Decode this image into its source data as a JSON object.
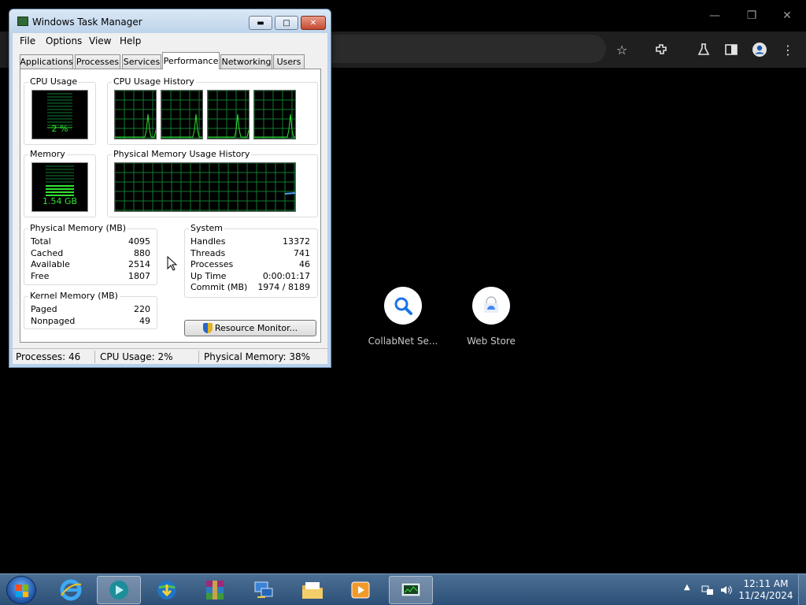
{
  "task_manager": {
    "title": "Windows Task Manager",
    "menu": [
      "File",
      "Options",
      "View",
      "Help"
    ],
    "tabs": [
      "Applications",
      "Processes",
      "Services",
      "Performance",
      "Networking",
      "Users"
    ],
    "active_tab": "Performance",
    "cpu_usage": {
      "label": "CPU Usage",
      "value": "2 %"
    },
    "cpu_history": {
      "label": "CPU Usage History"
    },
    "memory": {
      "label": "Memory",
      "value": "1.54 GB"
    },
    "memory_history": {
      "label": "Physical Memory Usage History"
    },
    "physical_memory": {
      "label": "Physical Memory (MB)",
      "rows": [
        {
          "key": "Total",
          "value": "4095"
        },
        {
          "key": "Cached",
          "value": "880"
        },
        {
          "key": "Available",
          "value": "2514"
        },
        {
          "key": "Free",
          "value": "1807"
        }
      ]
    },
    "system": {
      "label": "System",
      "rows": [
        {
          "key": "Handles",
          "value": "13372"
        },
        {
          "key": "Threads",
          "value": "741"
        },
        {
          "key": "Processes",
          "value": "46"
        },
        {
          "key": "Up Time",
          "value": "0:00:01:17"
        },
        {
          "key": "Commit (MB)",
          "value": "1974 / 8189"
        }
      ]
    },
    "kernel_memory": {
      "label": "Kernel Memory (MB)",
      "rows": [
        {
          "key": "Paged",
          "value": "220"
        },
        {
          "key": "Nonpaged",
          "value": "49"
        }
      ]
    },
    "resource_monitor_button": "Resource Monitor...",
    "status": {
      "processes": "Processes: 46",
      "cpu": "CPU Usage: 2%",
      "memory": "Physical Memory: 38%"
    }
  },
  "browser": {
    "shortcuts": [
      {
        "label": "CollabNet Se...",
        "icon": "search-icon"
      },
      {
        "label": "Web Store",
        "icon": "web-store-icon"
      }
    ]
  },
  "taskbar": {
    "clock_time": "12:11 AM",
    "clock_date": "11/24/2024",
    "items": [
      "internet-explorer-icon",
      "media-app-icon",
      "download-manager-icon",
      "winrar-icon",
      "network-app-icon",
      "file-explorer-icon",
      "media-player-icon",
      "task-manager-icon"
    ]
  },
  "colors": {
    "graph_green": "#31e231",
    "grid_green": "#0f7a2e",
    "taskbar_blue": "#2c4f77",
    "accent_blue": "#1a73e8"
  }
}
